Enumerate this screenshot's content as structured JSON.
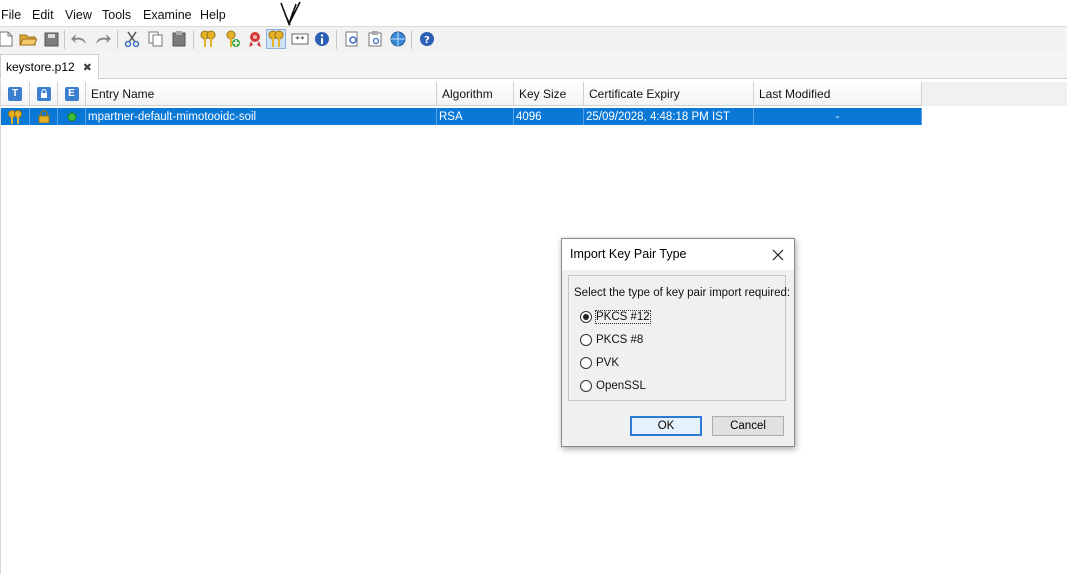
{
  "menu": [
    "File",
    "Edit",
    "View",
    "Tools",
    "Examine",
    "Help"
  ],
  "tab": {
    "label": "keystore.p12",
    "close_glyph": "✖"
  },
  "table": {
    "icon_headers": [
      "T",
      "E"
    ],
    "columns": [
      "Entry Name",
      "Algorithm",
      "Key Size",
      "Certificate Expiry",
      "Last Modified"
    ],
    "rows": [
      {
        "entry_name": "mpartner-default-mimotooidc-soil",
        "algorithm": "RSA",
        "key_size": "4096",
        "certificate_expiry": "25/09/2028, 4:48:18 PM IST",
        "last_modified": "-"
      }
    ]
  },
  "dialog": {
    "title": "Import Key Pair Type",
    "prompt": "Select the type of key pair import required:",
    "options": [
      "PKCS #12",
      "PKCS #8",
      "PVK",
      "OpenSSL"
    ],
    "selected_index": 0,
    "ok_label": "OK",
    "cancel_label": "Cancel"
  },
  "colors": {
    "selection": "#0a78d7",
    "header_icon": "#3c7fd1",
    "default_button_border": "#2f7ad5"
  }
}
